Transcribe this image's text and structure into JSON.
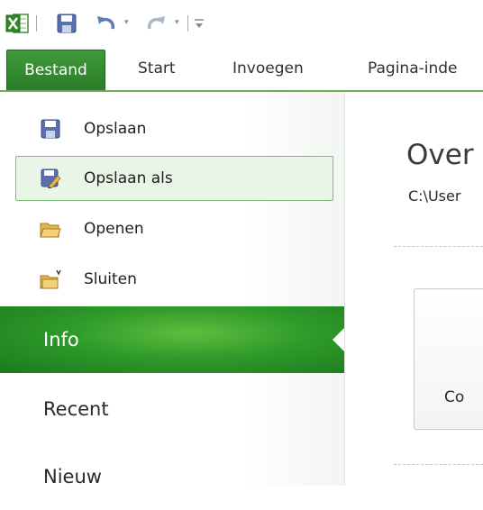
{
  "colors": {
    "accent": "#2b8a2a",
    "selected_bg": "#e9f5e6",
    "selected_border": "#7fbf73"
  },
  "quick_access": {
    "icons": [
      "excel-app-icon",
      "save-icon",
      "undo-icon",
      "redo-icon",
      "customize-qat-icon"
    ]
  },
  "ribbon": {
    "file_tab": "Bestand",
    "tabs": [
      "Start",
      "Invoegen",
      "Pagina-inde"
    ]
  },
  "backstage": {
    "commands": [
      {
        "label": "Opslaan",
        "icon": "save-icon"
      },
      {
        "label": "Opslaan als",
        "icon": "save-as-icon",
        "selected": true
      },
      {
        "label": "Openen",
        "icon": "open-folder-icon"
      },
      {
        "label": "Sluiten",
        "icon": "close-folder-icon"
      }
    ],
    "sections": [
      {
        "label": "Info",
        "active": true
      },
      {
        "label": "Recent"
      },
      {
        "label": "Nieuw"
      }
    ]
  },
  "info_pane": {
    "title": "Over",
    "path": "C:\\User",
    "card_label": "Co"
  }
}
